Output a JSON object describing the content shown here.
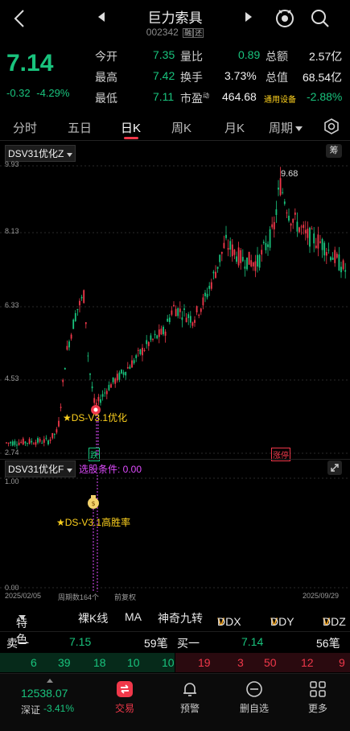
{
  "header": {
    "title": "巨力索具",
    "code": "002342",
    "margin_badge": "融",
    "bond_badge": "还"
  },
  "quote": {
    "price": "7.14",
    "change": "-0.32",
    "change_pct": "-4.29%",
    "rows": [
      [
        {
          "label": "今开",
          "value": "7.35",
          "color": "green"
        },
        {
          "label": "量比",
          "value": "0.89",
          "color": "green"
        },
        {
          "label": "总额",
          "value": "2.57亿",
          "color": "white"
        }
      ],
      [
        {
          "label": "最高",
          "value": "7.42",
          "color": "green"
        },
        {
          "label": "换手",
          "value": "3.73%",
          "color": "white"
        },
        {
          "label": "总值",
          "value": "68.54亿",
          "color": "white"
        }
      ],
      [
        {
          "label": "最低",
          "value": "7.11",
          "color": "green"
        },
        {
          "label": "市盈",
          "value": "464.68",
          "color": "white"
        },
        {
          "label": "通用设备",
          "value": "-2.88%",
          "color": "green"
        }
      ]
    ],
    "pe_superscript": "动"
  },
  "tabs": [
    "分时",
    "五日",
    "日K",
    "周K",
    "月K",
    "周期"
  ],
  "active_tab": "日K",
  "main_chart": {
    "indicator": "DSV31优化Z",
    "chip_label": "筹",
    "y_ticks": [
      "9.93",
      "8.13",
      "6.33",
      "4.53",
      "2.74"
    ],
    "high_label": "9.68",
    "signal_label": "★DS-V3.1优化",
    "bottom_tag_left": "跌",
    "bottom_tag_right": "涨停"
  },
  "sub_chart": {
    "indicator": "DSV31优化F",
    "condition_label": "选股条件: 0.00",
    "y_ticks": [
      "1.00",
      "0.00"
    ],
    "signal_label": "★DS-V3.1高胜率"
  },
  "footer_axis": {
    "start_date": "2025/02/05",
    "period_count": "周期数164个",
    "adjust": "前复权",
    "end_date": "2025/09/29"
  },
  "indicator_buttons": [
    "特色",
    "裸K线",
    "MA",
    "神奇九转",
    "DDX",
    "DDY",
    "DDZ"
  ],
  "orderbook": {
    "sell_label": "卖一",
    "sell_price": "7.15",
    "sell_qty": "59笔",
    "buy_label": "买一",
    "buy_price": "7.14",
    "buy_qty": "56笔",
    "sell_orders": [
      "6",
      "39",
      "18",
      "10",
      "10"
    ],
    "buy_orders": [
      "19",
      "3",
      "50",
      "12",
      "9"
    ]
  },
  "bottom_nav": {
    "index_value": "12538.07",
    "index_name": "深证",
    "index_change": "-3.41%",
    "items": [
      "交易",
      "预警",
      "删自选",
      "更多"
    ]
  },
  "colors": {
    "up": "#f0384a",
    "down": "#19c37d",
    "accent": "#ffd21e",
    "signal": "#e04bff"
  }
}
